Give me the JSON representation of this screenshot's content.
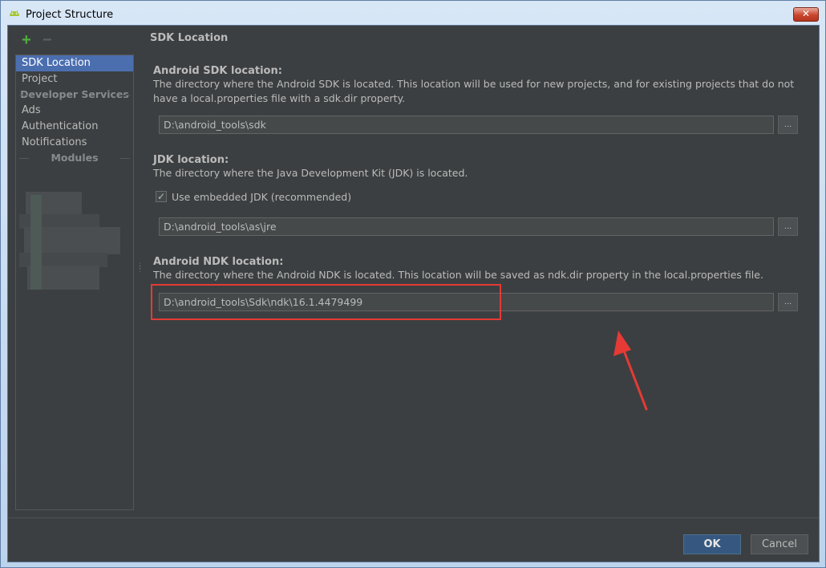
{
  "window": {
    "title": "Project Structure",
    "close_label": "✕"
  },
  "toolbar": {
    "add_label": "+",
    "remove_label": "−"
  },
  "sidebar": {
    "items": [
      {
        "label": "SDK Location",
        "selected": true
      },
      {
        "label": "Project"
      }
    ],
    "developer_services_header": "Developer Services",
    "services": [
      {
        "label": "Ads"
      },
      {
        "label": "Authentication"
      },
      {
        "label": "Notifications"
      }
    ],
    "modules_header": "Modules"
  },
  "main": {
    "section_title": "SDK Location",
    "android_sdk": {
      "heading": "Android SDK location:",
      "description": "The directory where the Android SDK is located. This location will be used for new projects, and for existing projects that do not have a local.properties file with a sdk.dir property.",
      "value": "D:\\android_tools\\sdk",
      "browse_label": "..."
    },
    "jdk": {
      "heading": "JDK location:",
      "description": "The directory where the Java Development Kit (JDK) is located.",
      "checkbox_label": "Use embedded JDK (recommended)",
      "checkbox_checked": true,
      "value": "D:\\android_tools\\as\\jre",
      "browse_label": "..."
    },
    "android_ndk": {
      "heading": "Android NDK location:",
      "description": "The directory where the Android NDK is located. This location will be saved as ndk.dir property in the local.properties file.",
      "value": "D:\\android_tools\\Sdk\\ndk\\16.1.4479499",
      "browse_label": "..."
    }
  },
  "footer": {
    "ok_label": "OK",
    "cancel_label": "Cancel"
  },
  "colors": {
    "panel_bg": "#3c3f41",
    "selection": "#4b6eaf",
    "annotation_red": "#e53a35",
    "ok_button": "#365880"
  }
}
